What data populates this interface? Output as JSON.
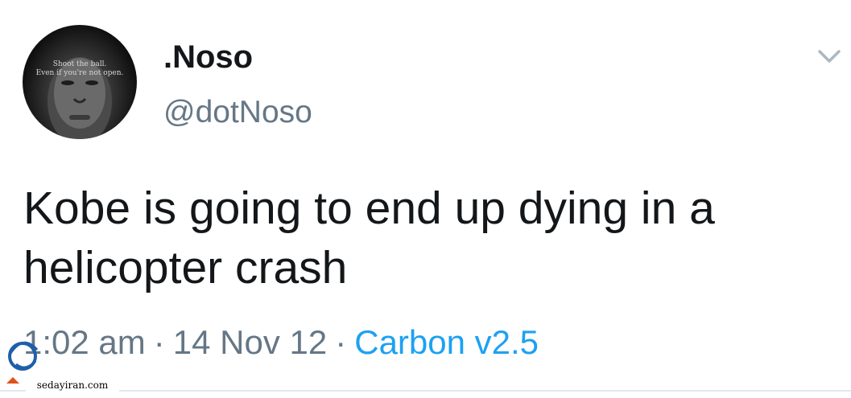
{
  "tweet": {
    "avatar": {
      "quote_line1": "Shoot the ball.",
      "quote_line2": "Even if you're not open."
    },
    "display_name": ".Noso",
    "handle": "@dotNoso",
    "text": "Kobe is going to end up dying in a helicopter crash",
    "time": "1:02 am",
    "separator": "·",
    "date": "14 Nov 12",
    "source": "Carbon v2.5",
    "menu_icon": "chevron-down-icon"
  },
  "watermark": {
    "site": "sedayiran.com"
  },
  "colors": {
    "text_primary": "#14171a",
    "text_secondary": "#657786",
    "link": "#1da1f2",
    "divider": "#e1e8ed"
  }
}
